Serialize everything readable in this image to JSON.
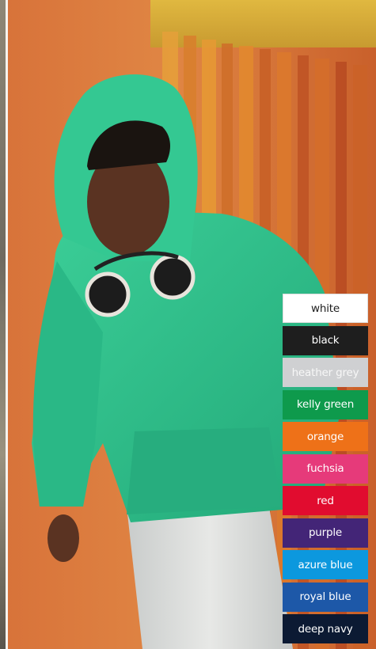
{
  "photo": {
    "subject": "child-in-kelly-green-hoodie",
    "colors": {
      "hoodie": "#2fbf8c",
      "background_orange": "#d87a3a",
      "shutter_orange": "#e08a2c",
      "wall_yellow": "#d9b43a"
    }
  },
  "swatches": [
    {
      "label": "white",
      "bg": "#ffffff",
      "fg": "#1c1c1c",
      "border": "#dddddd"
    },
    {
      "label": "black",
      "bg": "#1e1e1e",
      "fg": "#ffffff",
      "border": "#1e1e1e"
    },
    {
      "label": "heather grey",
      "bg": "#cfd0d2",
      "fg": "#f7f7f7",
      "border": "#cfd0d2"
    },
    {
      "label": "kelly green",
      "bg": "#0e9a4c",
      "fg": "#ffffff",
      "border": "#0e9a4c"
    },
    {
      "label": "orange",
      "bg": "#ee7118",
      "fg": "#ffffff",
      "border": "#ee7118"
    },
    {
      "label": "fuchsia",
      "bg": "#e63a7a",
      "fg": "#ffffff",
      "border": "#e63a7a"
    },
    {
      "label": "red",
      "bg": "#e10c2f",
      "fg": "#ffffff",
      "border": "#e10c2f"
    },
    {
      "label": "purple",
      "bg": "#432577",
      "fg": "#ffffff",
      "border": "#432577"
    },
    {
      "label": "azure blue",
      "bg": "#0c98de",
      "fg": "#ffffff",
      "border": "#0c98de"
    },
    {
      "label": "royal blue",
      "bg": "#1d58a8",
      "fg": "#ffffff",
      "border": "#1d58a8"
    },
    {
      "label": "deep navy",
      "bg": "#0c1a33",
      "fg": "#ffffff",
      "border": "#0c1a33"
    }
  ]
}
